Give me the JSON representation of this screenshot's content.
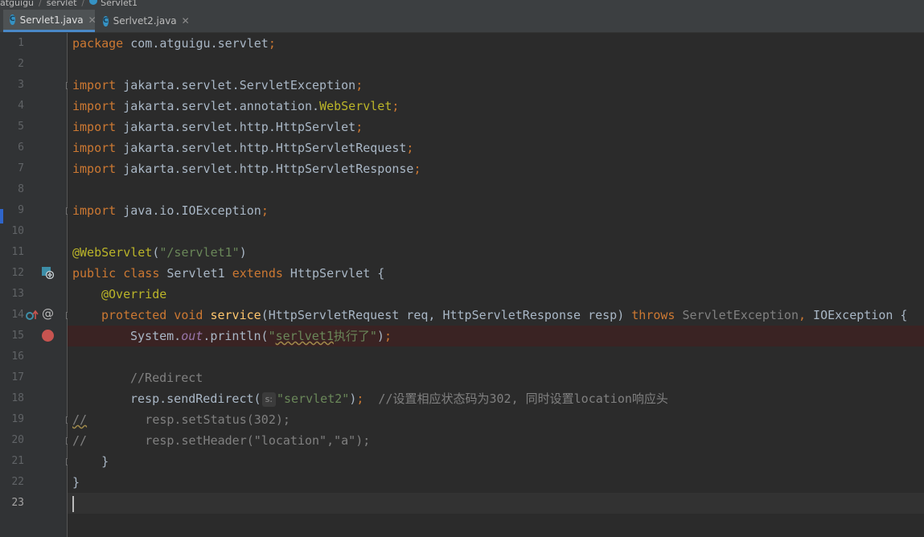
{
  "breadcrumb": {
    "items": [
      "atguigu",
      "servlet",
      "Servlet1"
    ]
  },
  "tabs": [
    {
      "label": "Servlet1.java",
      "active": true,
      "icon": "java-class-icon",
      "close": "✕"
    },
    {
      "label": "Serlvet2.java",
      "active": false,
      "icon": "java-class-icon",
      "close": "✕"
    }
  ],
  "line_numbers": [
    "1",
    "2",
    "3",
    "4",
    "5",
    "6",
    "7",
    "8",
    "9",
    "10",
    "11",
    "12",
    "13",
    "14",
    "15",
    "16",
    "17",
    "18",
    "19",
    "20",
    "21",
    "22",
    "23"
  ],
  "code": {
    "l1": {
      "kw": "package",
      "rest": " com.atguigu.servlet",
      "semi": ";"
    },
    "l3": {
      "kw": "import",
      "rest": " jakarta.servlet.ServletException",
      "semi": ";"
    },
    "l4": {
      "kw": "import",
      "rest": " jakarta.servlet.annotation.",
      "ann": "WebServlet",
      "semi": ";"
    },
    "l5": {
      "kw": "import",
      "rest": " jakarta.servlet.http.HttpServlet",
      "semi": ";"
    },
    "l6": {
      "kw": "import",
      "rest": " jakarta.servlet.http.HttpServletRequest",
      "semi": ";"
    },
    "l7": {
      "kw": "import",
      "rest": " jakarta.servlet.http.HttpServletResponse",
      "semi": ";"
    },
    "l9": {
      "kw": "import",
      "rest": " java.io.IOException",
      "semi": ";"
    },
    "l11": {
      "ann": "@WebServlet",
      "open": "(",
      "str": "\"/servlet1\"",
      "close": ")"
    },
    "l12": {
      "kw1": "public",
      "kw2": " class",
      "name": " Servlet1 ",
      "kw3": "extends",
      "rest": " HttpServlet {"
    },
    "l13": {
      "ann": "@Override"
    },
    "l14": {
      "kw1": "protected",
      "kw2": " void",
      "fn": " service",
      "params": "(HttpServletRequest req, HttpServletResponse resp) ",
      "kw3": "throws",
      "ex1": " ServletException",
      "comma": ",",
      "ex2": " IOException {"
    },
    "l15": {
      "pre": "System.",
      "fld": "out",
      "mid": ".println(",
      "q1": "\"",
      "squig": "serlvet1",
      "strrest": "执行了\"",
      "end": ")",
      "semi": ";"
    },
    "l17": {
      "cmt": "//Redirect"
    },
    "l18": {
      "pre": "resp.sendRedirect(",
      "hint": "s:",
      "str": "\"servlet2\"",
      "end": ")",
      "semi": ";",
      "cmt": "  //设置相应状态码为302, 同时设置location响应头"
    },
    "l19": {
      "cmt1": "//",
      "rest": "        resp.setStatus(302);"
    },
    "l20": {
      "cmt1": "//",
      "rest": "        resp.setHeader(\"location\",\"a\");"
    },
    "l21": {
      "text": "    }"
    },
    "l22": {
      "text": "}"
    }
  },
  "gutter_icons": {
    "l12": "web-servlet-icon",
    "l14": "override-up-arrow-icon",
    "l14b": "annotation-at-icon",
    "l15": "breakpoint-icon"
  },
  "colors": {
    "keyword": "#cc7832",
    "annotation": "#bbb529",
    "string": "#6a8759",
    "comment": "#808080",
    "method": "#ffc66d",
    "breakpoint": "#c75450",
    "background": "#2b2b2b"
  }
}
